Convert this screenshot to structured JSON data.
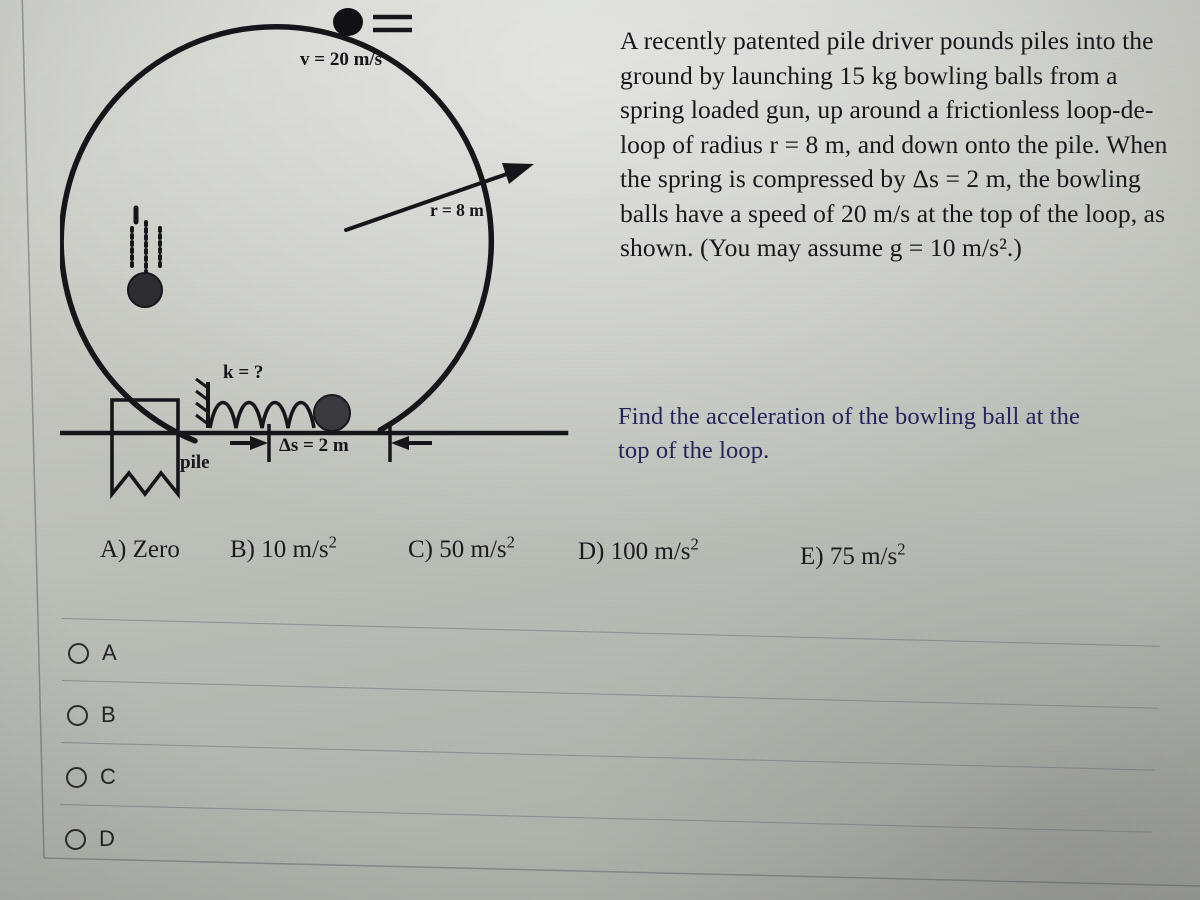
{
  "problem": {
    "statement": "A recently patented pile driver pounds piles into the ground by launching 15 kg bowling balls from a spring loaded gun, up around a frictionless loop-de-loop of radius r = 8 m, and down onto the pile. When the spring is compressed by Δs = 2 m,  the bowling balls have a speed of 20 m/s at the top of the loop, as shown. (You may assume g = 10 m/s².)",
    "question": "Find the acceleration of the bowling ball at the top of the loop."
  },
  "diagram": {
    "velocity_label": "v = 20 m/s",
    "radius_label": "r = 8 m",
    "spring_constant_label": "k = ?",
    "compression_label": "Δs = 2 m",
    "pile_label": "pile"
  },
  "choices_inline": [
    {
      "key": "A",
      "text": "A) Zero",
      "value": "Zero",
      "unit": ""
    },
    {
      "key": "B",
      "text": "B) 10 m/s",
      "value": "10",
      "unit": "m/s²",
      "sup": "2"
    },
    {
      "key": "C",
      "text": "C) 50 m/s",
      "value": "50",
      "unit": "m/s²",
      "sup": "2"
    },
    {
      "key": "D",
      "text": "D) 100 m/s",
      "value": "100",
      "unit": "m/s²",
      "sup": "2"
    },
    {
      "key": "E",
      "text": "E) 75 m/s",
      "value": "75",
      "unit": "m/s²",
      "sup": "2"
    }
  ],
  "options": [
    {
      "label": "A",
      "selected": false
    },
    {
      "label": "B",
      "selected": false
    },
    {
      "label": "C",
      "selected": false
    },
    {
      "label": "D",
      "selected": false
    }
  ],
  "colors": {
    "page_background": "#c2c4be",
    "ink": "#17171c",
    "question_ink": "#24245c",
    "divider": "#73757a"
  }
}
